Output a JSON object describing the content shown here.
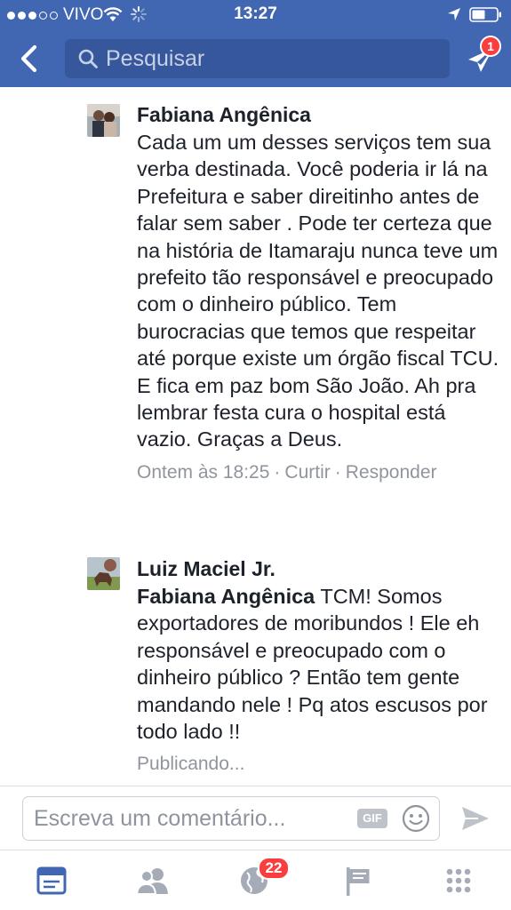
{
  "status_bar": {
    "carrier": "VIVO",
    "time": "13:27"
  },
  "nav": {
    "search_placeholder": "Pesquisar",
    "messenger_badge": "1"
  },
  "comments": [
    {
      "author": "Fabiana Angênica",
      "text": "Cada um um desses serviços tem sua verba destinada.  Você poderia ir lá na Prefeitura e saber direitinho antes de falar sem saber . Pode ter certeza que na história de Itamaraju nunca teve um prefeito tão responsável e preocupado com o dinheiro público.  Tem burocracias que temos que respeitar até porque existe um órgão fiscal TCU. E fica em paz bom São João.  Ah pra lembrar festa cura o hospital está vazio. Graças a Deus.",
      "timestamp": "Ontem às 18:25",
      "like_label": "Curtir",
      "reply_label": "Responder"
    },
    {
      "author": "Luiz Maciel Jr.",
      "mention": "Fabiana Angênica",
      "text": " TCM! Somos exportadores de moribundos ! Ele eh responsável e preocupado com o dinheiro público ? Então tem gente mandando nele ! Pq atos escusos por todo lado !!",
      "status": "Publicando..."
    }
  ],
  "composer": {
    "placeholder": "Escreva um comentário...",
    "gif_label": "GIF"
  },
  "tabbar": {
    "notifications_badge": "22"
  },
  "colors": {
    "brand": "#4267b2",
    "active_tab": "#4267b2",
    "inactive_tab": "#a5acb7",
    "badge": "#fa3e3e"
  }
}
